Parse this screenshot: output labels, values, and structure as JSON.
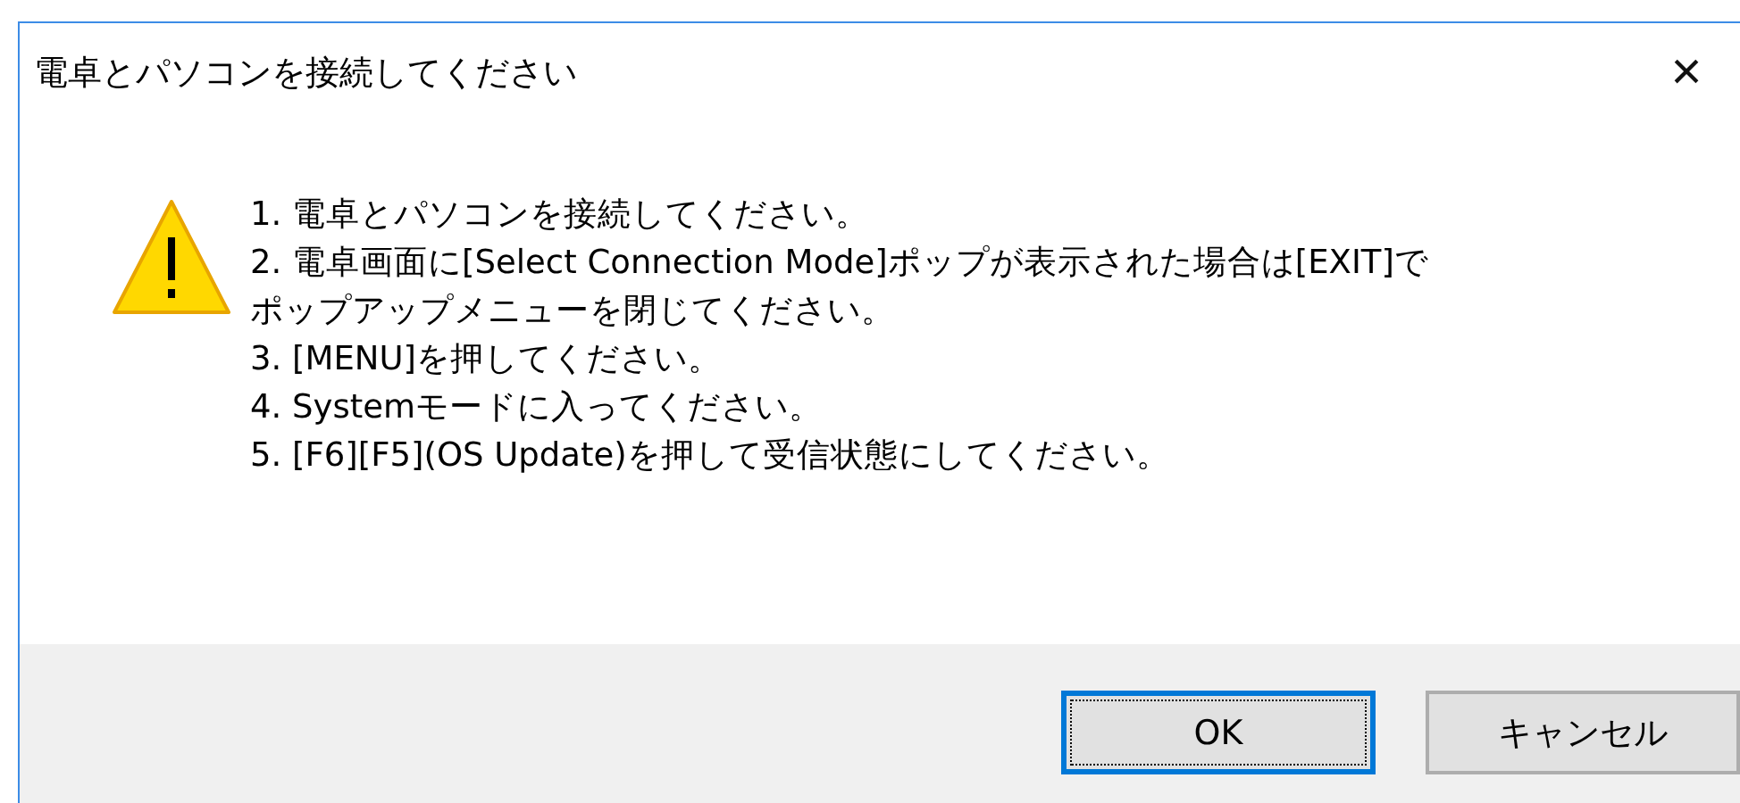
{
  "window": {
    "title": "電卓とパソコンを接続してください",
    "close": "×"
  },
  "message": {
    "kind": "warning",
    "items": [
      [
        "1. 電卓とパソコンを接続してください。"
      ],
      [
        "2. 電卓画面に[Select Connection Mode]ポップが表示された場合は[EXIT]で",
        "ポップアップメニューを閉じてください。"
      ],
      [
        "3. [MENU]を押してください。"
      ],
      [
        "4. Systemモードに入ってください。"
      ],
      [
        "5. [F6][F5](OS Update)を押して受信状態にしてください。"
      ]
    ]
  },
  "buttons": [
    {
      "label": "OK",
      "default": true
    },
    {
      "label": "キャンセル",
      "default": false
    }
  ]
}
